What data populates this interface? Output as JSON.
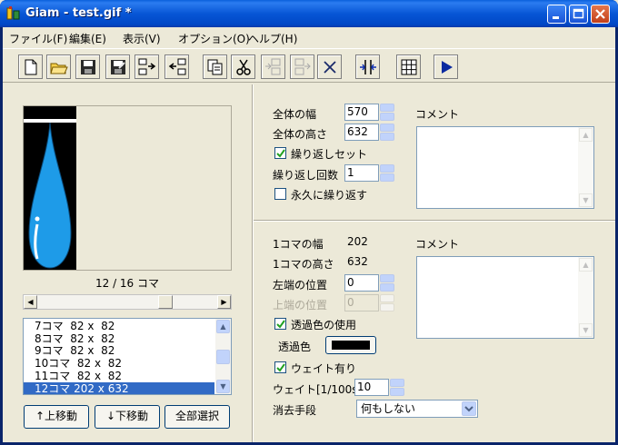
{
  "window": {
    "title": "Giam - test.gif *"
  },
  "menu": [
    "ファイル(F)",
    "編集(E)",
    "表示(V)",
    "オプション(O)",
    "ヘルプ(H)"
  ],
  "toolbar": {
    "buttons": [
      "new-file-icon",
      "open-folder-icon",
      "save-icon",
      "save-as-icon",
      "import-frame-icon",
      "export-frame-icon",
      "copy-icon",
      "cut-icon",
      "paste-before-icon",
      "paste-after-icon",
      "delete-icon",
      "fit-size-icon",
      "grid-icon",
      "play-icon"
    ]
  },
  "preview": {
    "frame_label": "12 / 16 コマ",
    "slider_position": 0.73
  },
  "frame_list": {
    "items": [
      "7コマ  82 x  82",
      "8コマ  82 x  82",
      "9コマ  82 x  82",
      "10コマ  82 x  82",
      "11コマ  82 x  82",
      "12コマ 202 x 632"
    ],
    "selected_index": 5
  },
  "buttons": {
    "move_up": "↑上移動",
    "move_down": "↓下移動",
    "select_all": "全部選択"
  },
  "global": {
    "width_label": "全体の幅",
    "width_value": "570",
    "height_label": "全体の高さ",
    "height_value": "632",
    "loop_set_label": "繰り返しセット",
    "loop_set_checked": true,
    "loop_count_label": "繰り返し回数",
    "loop_count_value": "1",
    "loop_forever_label": "永久に繰り返す",
    "loop_forever_checked": false,
    "comment_label": "コメント"
  },
  "frame": {
    "width_label": "1コマの幅",
    "width_value": "202",
    "height_label": "1コマの高さ",
    "height_value": "632",
    "left_label": "左端の位置",
    "left_value": "0",
    "top_label": "上端の位置",
    "top_value": "0",
    "transparent_label": "透過色の使用",
    "transparent_checked": true,
    "transparent_color_label": "透過色",
    "transparent_color": "#000000",
    "wait_label": "ウェイト有り",
    "wait_checked": true,
    "wait_value_label": "ウェイト[1/100s]",
    "wait_value": "10",
    "disposal_label": "消去手段",
    "disposal_value": "何もしない",
    "comment_label": "コメント"
  },
  "colors": {
    "title_bar": "#0756d6",
    "selection": "#316ac5",
    "drop_fill": "#1e9be8",
    "face": "#ece9d8"
  }
}
